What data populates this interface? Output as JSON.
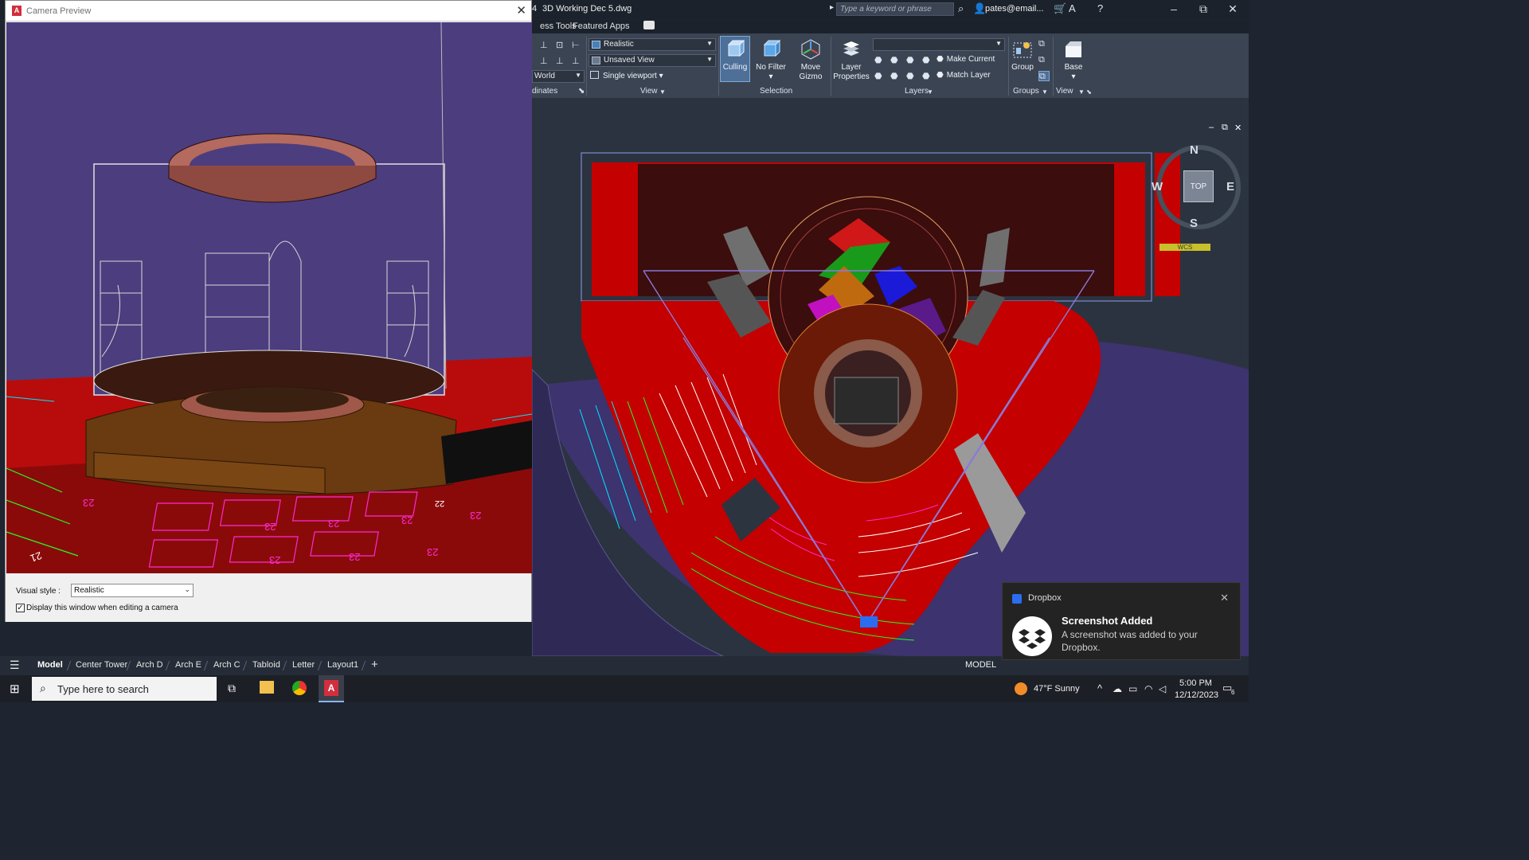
{
  "window": {
    "document_title": "3D Working Dec 5.dwg",
    "title_prefix": "4",
    "search_placeholder": "Type a keyword or phrase",
    "user": "pates@email...",
    "minimize": "–",
    "restore": "⧉",
    "close": "✕"
  },
  "ribbon": {
    "tabs": [
      "ess Tools",
      "Featured Apps"
    ],
    "coordinates": {
      "world_label": "World",
      "panel_label": "dinates"
    },
    "view_panel": {
      "visual_style": "Realistic",
      "named_view": "Unsaved View",
      "viewport": "Single viewport",
      "panel_label": "View"
    },
    "selection_panel": {
      "culling": "Culling",
      "no_filter": "No Filter",
      "move_gizmo": "Move Gizmo",
      "panel_label": "Selection"
    },
    "layers_panel": {
      "layer_properties": "Layer Properties",
      "make_current": "Make Current",
      "match_layer": "Match Layer",
      "panel_label": "Layers"
    },
    "groups_panel": {
      "group": "Group",
      "panel_label": "Groups"
    },
    "view2_panel": {
      "base": "Base",
      "panel_label": "View"
    }
  },
  "viewcube": {
    "north": "N",
    "south": "S",
    "east": "E",
    "west": "W",
    "face": "TOP",
    "wcs": "WCS"
  },
  "camera_preview": {
    "title": "Camera Preview",
    "visual_style_label": "Visual style :",
    "visual_style_value": "Realistic",
    "checkbox_label": "Display this window when editing a camera",
    "checkbox_checked": true,
    "seat_labels": [
      "23",
      "23",
      "23",
      "23",
      "23",
      "23",
      "23",
      "23",
      "21",
      "22"
    ]
  },
  "layout_tabs": {
    "tabs": [
      "Model",
      "Center Tower",
      "Arch D",
      "Arch E",
      "Arch C",
      "Tabloid",
      "Letter",
      "Layout1"
    ],
    "active": "Model",
    "add": "+",
    "mode": "MODEL"
  },
  "taskbar": {
    "search_placeholder": "Type here to search",
    "weather": "47°F  Sunny",
    "time": "5:00 PM",
    "date": "12/12/2023",
    "notification_count": "6"
  },
  "toast": {
    "app": "Dropbox",
    "title": "Screenshot Added",
    "message": "A screenshot was added to your Dropbox."
  },
  "colors": {
    "accent": "#4d6f98",
    "stage_red": "#c40000",
    "house_purple": "#4a3a7a",
    "autocad_red": "#d22e3d"
  }
}
